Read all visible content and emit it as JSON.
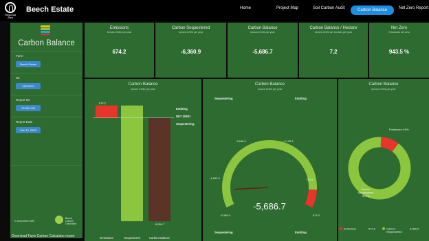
{
  "app": {
    "logo_text": "Regional Zero",
    "title": "Beech Estate"
  },
  "nav": {
    "items": [
      "Home",
      "Project Map",
      "Soil Carbon Audit",
      "Carbon Balance",
      "Net Zero Report"
    ],
    "active": "Carbon Balance"
  },
  "sidebar": {
    "title": "Carbon Balance",
    "farm_label": "Farm",
    "farm_value": "Beech Estate",
    "sit_label": "SIt",
    "sit_value": "18072024",
    "report_no_label": "Report No",
    "report_no_value": "1234Ex799",
    "report_date_label": "Report Date",
    "report_date_value": "Feb 13, 2023",
    "credit": "in association with",
    "calc_mark": "Beech Carbon Calculator",
    "download": "Download Farm Carbon Calculator report"
  },
  "kpis": [
    {
      "title": "Emissions",
      "sub": "tonnes CO2e per year",
      "value": "674.2"
    },
    {
      "title": "Carbon Sequestered",
      "sub": "tonnes CO2e per year",
      "value": "-6,360.9"
    },
    {
      "title": "Carbon Balance",
      "sub": "tonnes CO2e per year",
      "value": "-5,686.7"
    },
    {
      "title": "Carbon Balance / Hectare",
      "sub": "tonnes CO2e per hectare per year",
      "value": "7.2"
    },
    {
      "title": "Net Zero",
      "sub": "% towards net zero",
      "value": "943.5 %"
    }
  ],
  "colors": {
    "panel": "#2e6b31",
    "emissions": "#e8342b",
    "sequestered": "#8cc63f",
    "balance": "#5a3527",
    "accent": "#1d8ee0"
  },
  "chart_data": [
    {
      "type": "bar",
      "title": "Carbon Balance",
      "subtitle": "tonnes CO2e per year",
      "categories": [
        "Emissions",
        "Sequestered",
        "Carbon Balance"
      ],
      "values": [
        674.2,
        -6360.9,
        -5686.7
      ],
      "ylim": [
        -6400,
        700
      ],
      "data_labels": [
        "674.2",
        "-5,686.7"
      ],
      "annotations": [
        "Emitting",
        "NET ZERO",
        "Sequestering"
      ],
      "legend": "none"
    },
    {
      "type": "gauge",
      "title": "Carbon Balance",
      "subtitle": "tonnes CO2e per year",
      "value": -5686.7,
      "display_value": "-5,686.7",
      "range": [
        -6360.9,
        674.2
      ],
      "tick_labels": [
        "-6,360.9",
        "-4,953.9",
        "-3,546.9",
        "-2,139.9",
        "732.9",
        "674.2"
      ],
      "corner_labels": [
        "Sequestering",
        "Emitting",
        "Sequestering",
        "Emitting"
      ]
    },
    {
      "type": "pie",
      "title": "Carbon Balance",
      "subtitle": "tonnes CO2e per year",
      "slices": [
        {
          "name": "Emissions",
          "value": 674.2,
          "label": "Emissions 9.6%"
        },
        {
          "name": "Carbon Sequestered",
          "value": 6360.9,
          "label": "Carbon Sequestered 90.4%"
        }
      ],
      "legend": "bottom",
      "legend_entries": [
        "Emissions",
        "674.2",
        "Carbon Sequestered",
        "6,360.9"
      ]
    }
  ]
}
